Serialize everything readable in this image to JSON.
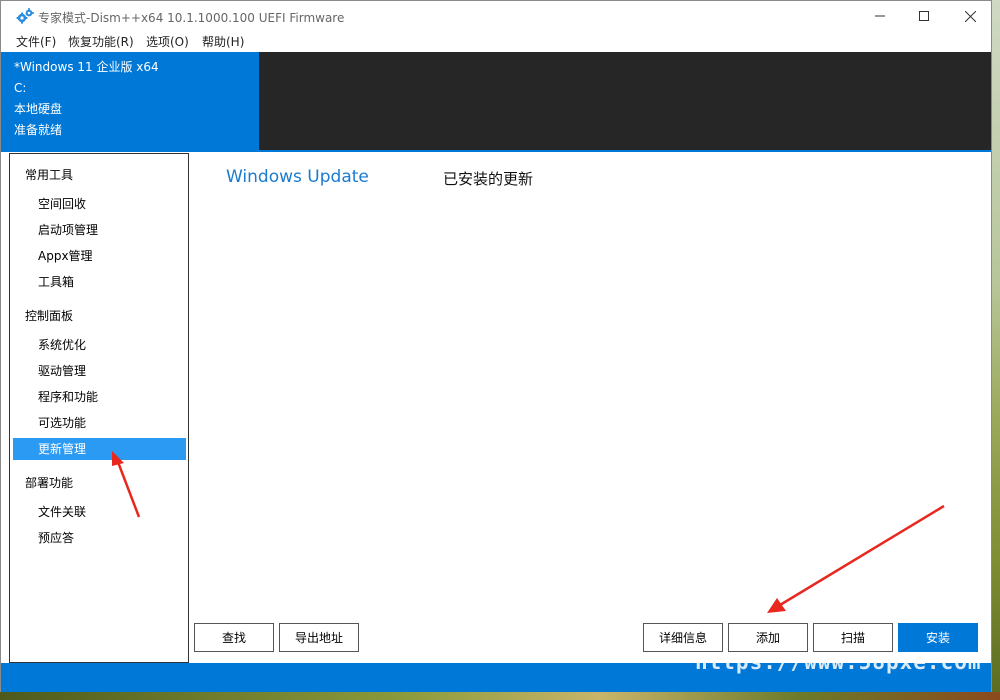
{
  "window": {
    "title": "专家模式-Dism++x64 10.1.1000.100 UEFI Firmware"
  },
  "menu": [
    {
      "label": "文件(F)"
    },
    {
      "label": "恢复功能(R)"
    },
    {
      "label": "选项(O)"
    },
    {
      "label": "帮助(H)"
    }
  ],
  "system": {
    "os": "*Windows 11 企业版 x64",
    "drive": "C:",
    "disk_type": "本地硬盘",
    "status": "准备就绪"
  },
  "sidebar": {
    "groups": [
      {
        "label": "常用工具",
        "items": [
          {
            "label": "空间回收"
          },
          {
            "label": "启动项管理"
          },
          {
            "label": "Appx管理"
          },
          {
            "label": "工具箱"
          }
        ]
      },
      {
        "label": "控制面板",
        "items": [
          {
            "label": "系统优化"
          },
          {
            "label": "驱动管理"
          },
          {
            "label": "程序和功能"
          },
          {
            "label": "可选功能"
          },
          {
            "label": "更新管理"
          }
        ]
      },
      {
        "label": "部署功能",
        "items": [
          {
            "label": "文件关联"
          },
          {
            "label": "预应答"
          }
        ]
      }
    ],
    "active_item": "更新管理"
  },
  "main": {
    "title": "Windows Update",
    "section": "已安装的更新"
  },
  "buttons": {
    "find": "查找",
    "export": "导出地址",
    "details": "详细信息",
    "add": "添加",
    "scan": "扫描",
    "install": "安装"
  },
  "watermark": "https://www.58pxe.com",
  "colors": {
    "accent": "#0078d7",
    "selected": "#2b9af3",
    "annotation_arrow": "#e8281e"
  }
}
